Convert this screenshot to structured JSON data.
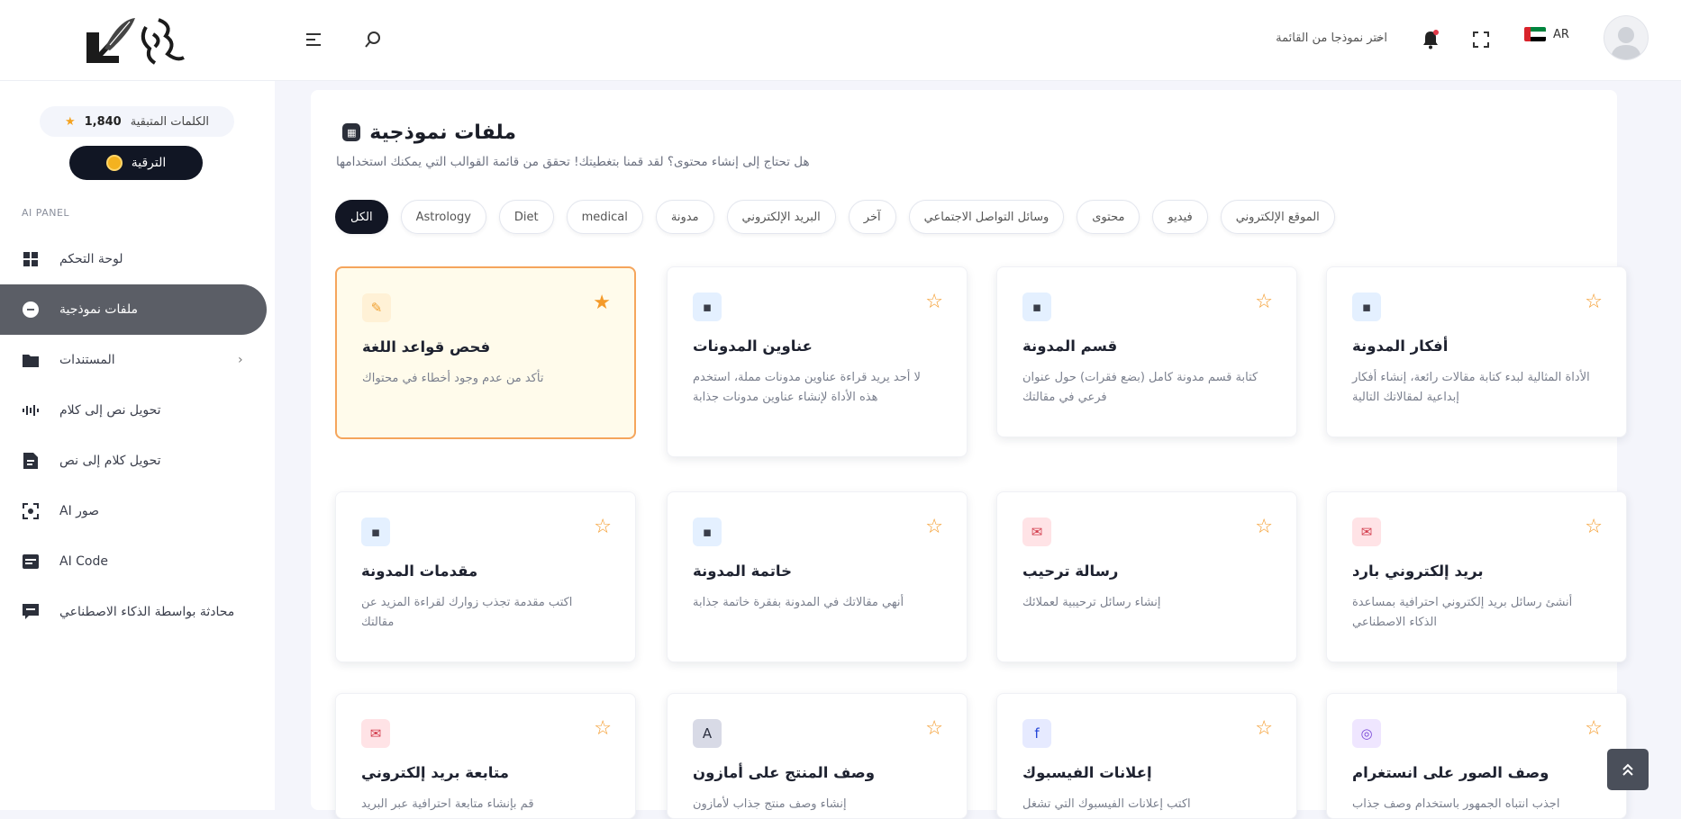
{
  "header": {
    "model_select": "اختر نموذجا من القائمة",
    "lang": "AR"
  },
  "sidebar": {
    "credits_label": "الكلمات المتبقية",
    "credits_value": "1,840",
    "upgrade_label": "الترقية",
    "panel_label": "AI PANEL",
    "items": [
      {
        "label": "لوحة التحكم",
        "icon": "dashboard-icon"
      },
      {
        "label": "ملفات نموذجية",
        "icon": "templates-icon",
        "active": true
      },
      {
        "label": "المستندات",
        "icon": "documents-icon",
        "has_children": true
      },
      {
        "label": "تحويل نص إلى كلام",
        "icon": "text-to-speech-icon"
      },
      {
        "label": "تحويل كلام إلى نص",
        "icon": "speech-to-text-icon"
      },
      {
        "label": "AI صور",
        "icon": "ai-image-icon"
      },
      {
        "label": "AI Code",
        "icon": "ai-code-icon"
      },
      {
        "label": "محادثة بواسطة الذكاء الاصطناعي",
        "icon": "ai-chat-icon"
      }
    ]
  },
  "main": {
    "title": "ملفات نموذجية",
    "subtitle": "هل تحتاج إلى إنشاء محتوى؟ لقد قمنا بتغطيتك! تحقق من قائمة القوالب التي يمكنك استخدامها",
    "filters": [
      "الكل",
      "Astrology",
      "Diet",
      "medical",
      "مدونة",
      "البريد الإلكتروني",
      "آخر",
      "وسائل التواصل الاجتماعي",
      "محتوى",
      "فيديو",
      "الموقع الإلكتروني"
    ],
    "active_filter": 0,
    "cards": [
      {
        "title": "فحص قواعد اللغة",
        "desc": "تأكد من عدم وجود أخطاء في محتواك",
        "icon": "grammar-icon",
        "icon_bg": "#fff1d6",
        "icon_color": "#f0a030",
        "starred": true
      },
      {
        "title": "عناوين المدونات",
        "desc": "لا أحد يريد قراءة عناوين مدونات مملة، استخدم هذه الأداة لإنشاء عناوين مدونات جذابة",
        "icon": "blog-icon",
        "icon_bg": "#e4f0ff",
        "icon_color": "#3a3e4a"
      },
      {
        "title": "قسم المدونة",
        "desc": "كتابة قسم مدونة كامل (بضع فقرات) حول عنوان فرعي في مقالتك",
        "icon": "blog-icon",
        "icon_bg": "#e4f0ff",
        "icon_color": "#3a3e4a"
      },
      {
        "title": "أفكار المدونة",
        "desc": "الأداة المثالية لبدء كتابة مقالات رائعة، إنشاء أفكار إبداعية لمقالاتك التالية",
        "icon": "blog-icon",
        "icon_bg": "#e4f0ff",
        "icon_color": "#3a3e4a"
      },
      {
        "title": "مقدمات المدونة",
        "desc": "اكتب مقدمة تجذب زوارك لقراءة المزيد عن مقالتك",
        "icon": "blog-icon",
        "icon_bg": "#e4f0ff",
        "icon_color": "#3a3e4a"
      },
      {
        "title": "خاتمة المدونة",
        "desc": "أنهي مقالاتك في المدونة بفقرة خاتمة جذابة",
        "icon": "blog-icon",
        "icon_bg": "#e4f0ff",
        "icon_color": "#3a3e4a"
      },
      {
        "title": "رسالة ترحيب",
        "desc": "إنشاء رسائل ترحيبية لعملائك",
        "icon": "mail-icon",
        "icon_bg": "#ffe3e6",
        "icon_color": "#d23a4a"
      },
      {
        "title": "بريد إلكتروني بارد",
        "desc": "أنشئ رسائل بريد إلكتروني احترافية بمساعدة الذكاء الاصطناعي",
        "icon": "mail-icon",
        "icon_bg": "#ffe3e6",
        "icon_color": "#d23a4a"
      },
      {
        "title": "متابعة بريد إلكتروني",
        "desc": "قم بإنشاء متابعة احترافية عبر البريد",
        "icon": "mail-icon",
        "icon_bg": "#ffe3e6",
        "icon_color": "#d23a4a"
      },
      {
        "title": "وصف المنتج على أمازون",
        "desc": "إنشاء وصف منتج جذاب لأمازون",
        "icon": "amazon-icon",
        "icon_bg": "#d8dae6",
        "icon_color": "#2c3040"
      },
      {
        "title": "إعلانات الفيسبوك",
        "desc": "اكتب إعلانات الفيسبوك التي تشغل",
        "icon": "facebook-icon",
        "icon_bg": "#e6eaff",
        "icon_color": "#2445d8"
      },
      {
        "title": "وصف الصور على انستغرام",
        "desc": "اجذب انتباه الجمهور باستخدام وصف جذاب",
        "icon": "instagram-icon",
        "icon_bg": "#efe6ff",
        "icon_color": "#7a4ad8"
      }
    ]
  },
  "colors": {
    "accent_dark": "#121624",
    "star": "#f49a2a",
    "highlight_border": "#f5a55c"
  }
}
